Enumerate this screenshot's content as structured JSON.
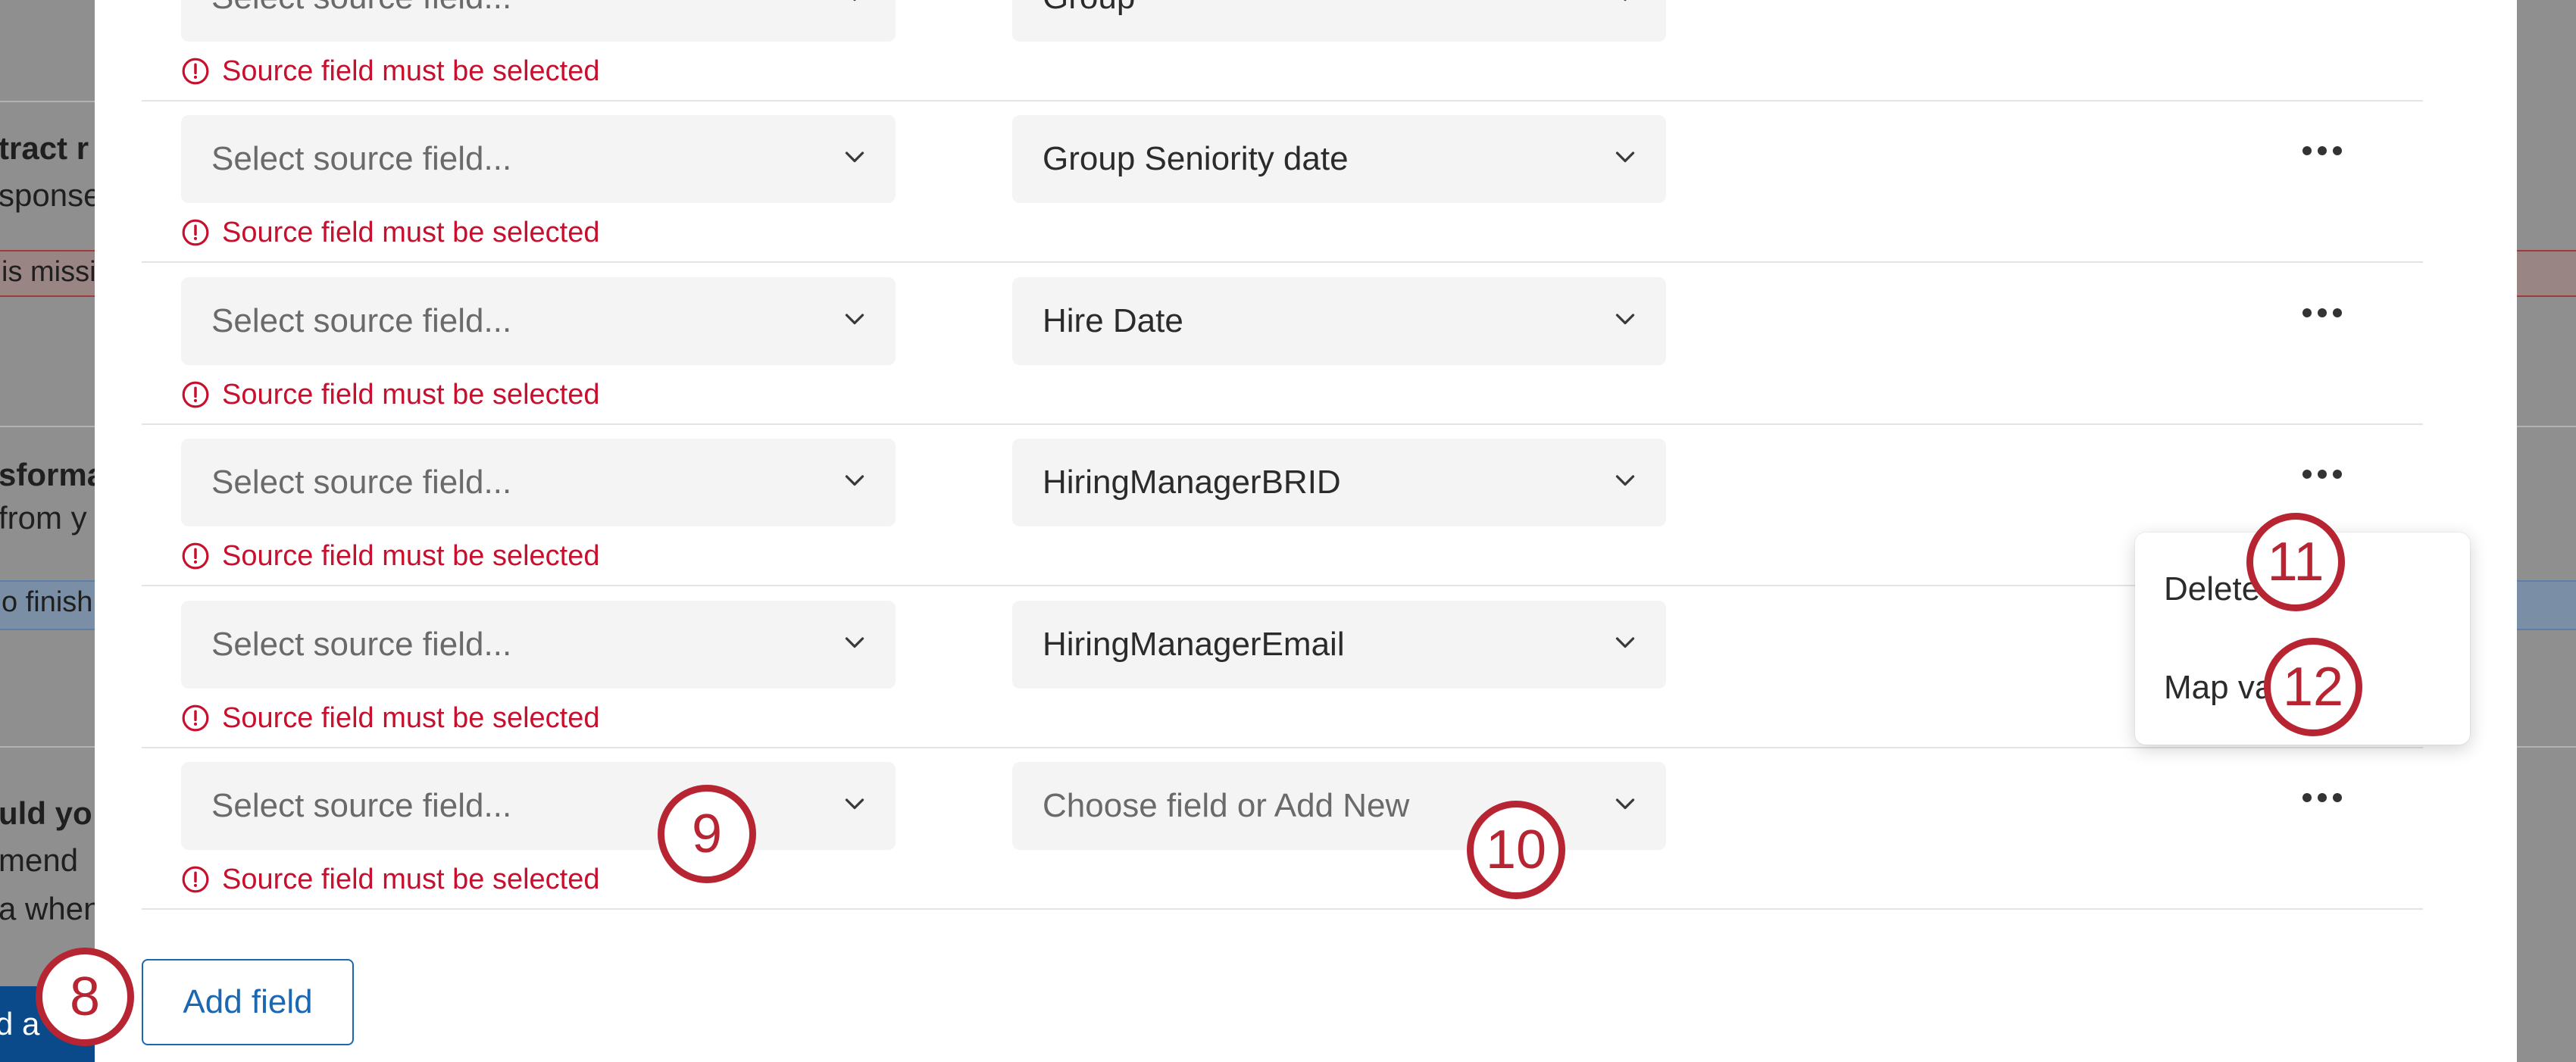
{
  "background": {
    "labels": {
      "l1": "tract r",
      "l2": "sponse",
      "l3": "is missi",
      "l4": "sforma",
      "l5": "from y",
      "l6": "o finish",
      "l7": "uld yo",
      "l8": "mend",
      "l9": "a when",
      "btn": "d a"
    }
  },
  "mapping": {
    "source_placeholder": "Select source field...",
    "error_message": "Source field must be selected",
    "rows": [
      {
        "target": "Group",
        "target_is_placeholder": false
      },
      {
        "target": "Group Seniority date",
        "target_is_placeholder": false
      },
      {
        "target": "Hire Date",
        "target_is_placeholder": false
      },
      {
        "target": "HiringManagerBRID",
        "target_is_placeholder": false
      },
      {
        "target": "HiringManagerEmail",
        "target_is_placeholder": false
      },
      {
        "target": "Choose field or Add New",
        "target_is_placeholder": true
      }
    ],
    "add_field_label": "Add field"
  },
  "row_menu": {
    "items": [
      "Delete row",
      "Map values"
    ]
  },
  "callouts": [
    "8",
    "9",
    "10",
    "11",
    "12"
  ],
  "colors": {
    "error": "#c8102e",
    "primary": "#1b67b1",
    "callout": "#b72533"
  },
  "icons": [
    "chevron-down-icon",
    "error-circle-icon",
    "more-horizontal-icon"
  ]
}
